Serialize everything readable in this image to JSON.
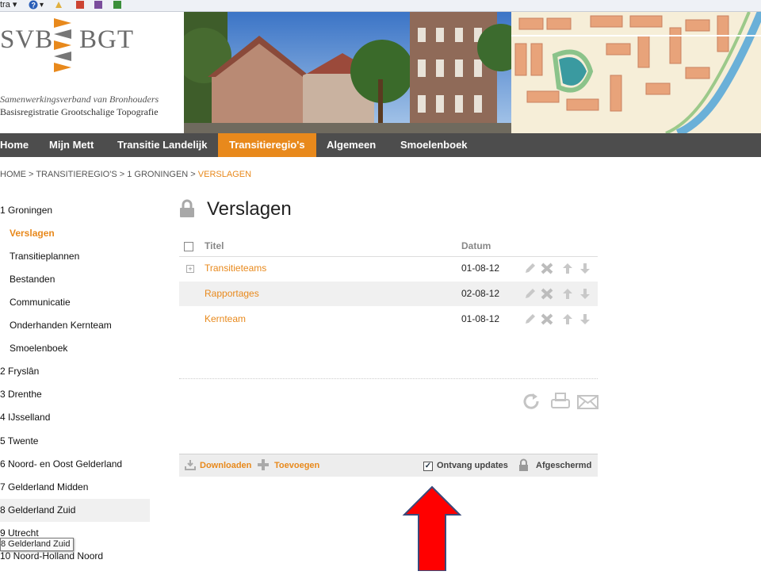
{
  "toolbar": {
    "label": "tra ▾",
    "help": "▾"
  },
  "header": {
    "logo_left": "SVB",
    "logo_right": "BGT",
    "tagline1": "Samenwerkingsverband van Bronhouders",
    "tagline2": "Basisregistratie Grootschalige Topografie"
  },
  "nav": {
    "items": [
      "Home",
      "Mijn Mett",
      "Transitie Landelijk",
      "Transitieregio's",
      "Algemeen",
      "Smoelenboek"
    ],
    "active": "Transitieregio's"
  },
  "breadcrumb": {
    "path": "HOME > TRANSITIEREGIO'S > 1 GRONINGEN > ",
    "current": "VERSLAGEN"
  },
  "sidebar": {
    "items": [
      "1 Groningen",
      "Verslagen",
      "Transitieplannen",
      "Bestanden",
      "Communicatie",
      "Onderhanden Kernteam",
      "Smoelenboek",
      "2 Fryslân",
      "3 Drenthe",
      "4 IJsselland",
      "5 Twente",
      "6 Noord- en Oost Gelderland",
      "7 Gelderland Midden",
      "8 Gelderland Zuid",
      "9 Utrecht",
      "10 Noord-Holland Noord"
    ],
    "selected": "Verslagen",
    "tooltip": "8 Gelderland Zuid"
  },
  "page": {
    "title": "Verslagen"
  },
  "table": {
    "headers": [
      "Titel",
      "Datum"
    ],
    "rows": [
      {
        "title": "Transitieteams",
        "date": "01-08-12",
        "expandable": "+"
      },
      {
        "title": "Rapportages",
        "date": "02-08-12"
      },
      {
        "title": "Kernteam",
        "date": "01-08-12"
      }
    ]
  },
  "footer": {
    "download": "Downloaden",
    "add": "Toevoegen",
    "updates": "Ontvang updates",
    "updates_checked": true,
    "updates_mark": "✓",
    "private": "Afgeschermd"
  },
  "colors": {
    "accent": "#e8891c",
    "nav_bg": "#4d4d4d",
    "annotation_arrow": "#ff0000"
  }
}
